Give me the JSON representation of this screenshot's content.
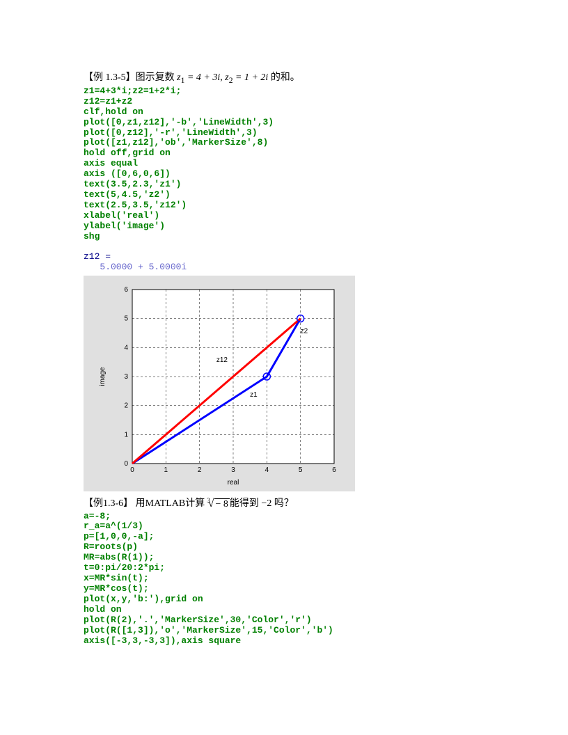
{
  "ex1": {
    "title_prefix": "【例 1.3-5】图示复数",
    "title_math": " z₁ = 4 + 3i, z₂ = 1 + 2i ",
    "title_suffix": "的和。",
    "code": "z1=4+3*i;z2=1+2*i;\nz12=z1+z2\nclf,hold on\nplot([0,z1,z12],'-b','LineWidth',3)\nplot([0,z12],'-r','LineWidth',3)\nplot([z1,z12],'ob','MarkerSize',8)\nhold off,grid on\naxis equal\naxis ([0,6,0,6])\ntext(3.5,2.3,'z1')\ntext(5,4.5,'z2')\ntext(2.5,3.5,'z12')\nxlabel('real')\nylabel('image')\nshg",
    "out_var": "z12 =",
    "out_val": "   5.0000 + 5.0000i"
  },
  "chart_data": {
    "type": "line",
    "xlabel": "real",
    "ylabel": "image",
    "xlim": [
      0,
      6
    ],
    "ylim": [
      0,
      6
    ],
    "xticks": [
      0,
      1,
      2,
      3,
      4,
      5,
      6
    ],
    "yticks": [
      0,
      1,
      2,
      3,
      4,
      5,
      6
    ],
    "series": [
      {
        "name": "blue",
        "color": "#0000ff",
        "width": 3,
        "x": [
          0,
          4,
          5
        ],
        "y": [
          0,
          3,
          5
        ]
      },
      {
        "name": "red",
        "color": "#ff0000",
        "width": 3,
        "x": [
          0,
          5
        ],
        "y": [
          0,
          5
        ]
      }
    ],
    "markers": [
      {
        "x": 4,
        "y": 3,
        "color": "#0000ff"
      },
      {
        "x": 5,
        "y": 5,
        "color": "#0000ff"
      }
    ],
    "annotations": [
      {
        "x": 3.5,
        "y": 2.3,
        "text": "z1"
      },
      {
        "x": 5.0,
        "y": 4.5,
        "text": "z2"
      },
      {
        "x": 2.5,
        "y": 3.5,
        "text": "z12"
      }
    ]
  },
  "ex2": {
    "title_prefix": "【例1.3-6】 用MATLAB计算",
    "title_math": " ∛(−8) ",
    "title_suffix": "能得到 −2 吗？",
    "code": "a=-8;\nr_a=a^(1/3)\np=[1,0,0,-a];\nR=roots(p)\nMR=abs(R(1));\nt=0:pi/20:2*pi;\nx=MR*sin(t);\ny=MR*cos(t);\nplot(x,y,'b:'),grid on\nhold on\nplot(R(2),'.','MarkerSize',30,'Color','r')\nplot(R([1,3]),'o','MarkerSize',15,'Color','b')\naxis([-3,3,-3,3]),axis square"
  }
}
